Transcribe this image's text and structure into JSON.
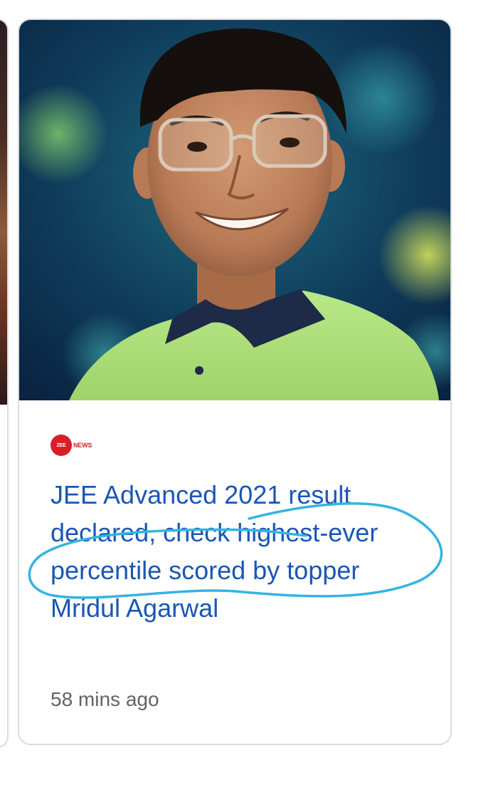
{
  "article": {
    "source_logo_letters": "ZEE",
    "source_logo_word": "NEWS",
    "headline": "JEE Advanced 2021 result declared, check highest-ever percentile scored by topper Mridul Agarwal",
    "time_ago": "58 mins ago"
  },
  "colors": {
    "headline": "#1a56b5",
    "annotation": "#35b4e0",
    "logo": "#d81f26",
    "card_border": "#dadce0"
  },
  "icons": {
    "thumbnail": "person-photo",
    "source_logo": "zee-news-logo"
  }
}
